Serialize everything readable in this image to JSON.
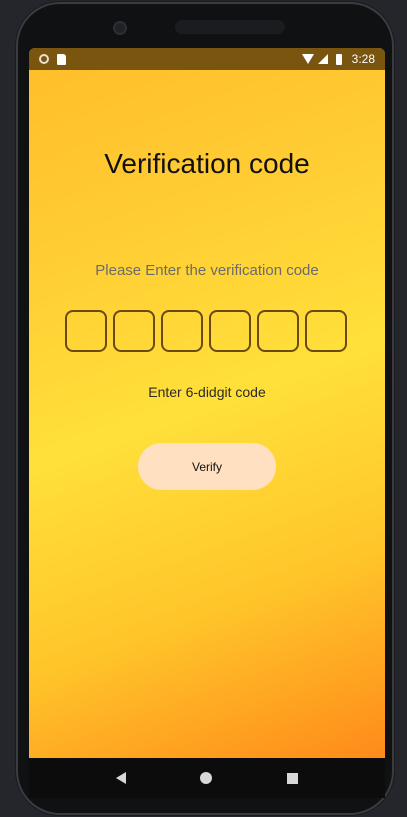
{
  "status_bar": {
    "time": "3:28",
    "icons": [
      "notification-dot-icon",
      "sd-card-icon",
      "wifi-icon",
      "signal-icon",
      "battery-icon"
    ]
  },
  "screen": {
    "title": "Verification code",
    "subtitle": "Please Enter the verification code",
    "code_boxes": [
      "",
      "",
      "",
      "",
      "",
      ""
    ],
    "hint": "Enter 6-didgit code",
    "verify_label": "Verify"
  },
  "nav_bar": {
    "icons": [
      "back-icon",
      "home-icon",
      "recents-icon"
    ]
  },
  "colors": {
    "gradient_start": "#ffbd2a",
    "gradient_mid": "#ffe03a",
    "gradient_end": "#ff8a1a",
    "status_bar": "#7a5510",
    "button_bg": "#ffe0c0",
    "box_border": "#6a4a10"
  }
}
